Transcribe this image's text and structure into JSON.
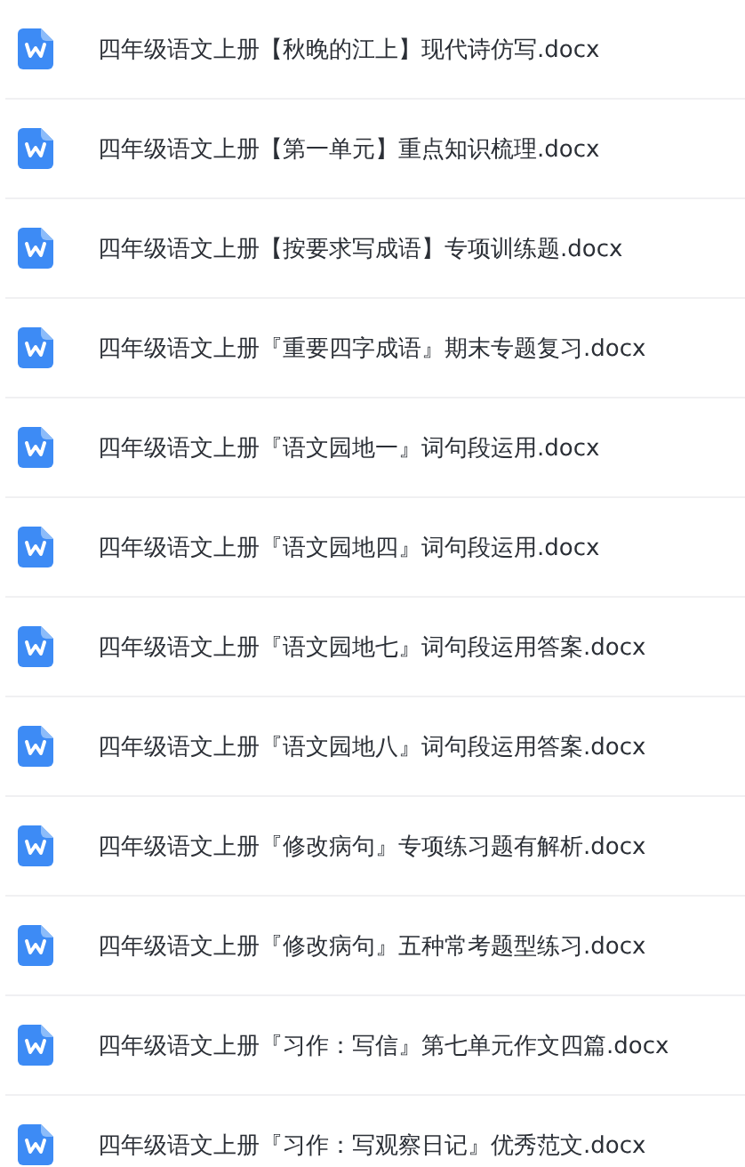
{
  "files": [
    {
      "name": "四年级语文上册【秋晚的江上】现代诗仿写.docx",
      "kind": "word"
    },
    {
      "name": "四年级语文上册【第一单元】重点知识梳理.docx",
      "kind": "word"
    },
    {
      "name": "四年级语文上册【按要求写成语】专项训练题.docx",
      "kind": "word"
    },
    {
      "name": "四年级语文上册『重要四字成语』期末专题复习.docx",
      "kind": "word"
    },
    {
      "name": "四年级语文上册『语文园地一』词句段运用.docx",
      "kind": "word"
    },
    {
      "name": "四年级语文上册『语文园地四』词句段运用.docx",
      "kind": "word"
    },
    {
      "name": "四年级语文上册『语文园地七』词句段运用答案.docx",
      "kind": "word"
    },
    {
      "name": "四年级语文上册『语文园地八』词句段运用答案.docx",
      "kind": "word"
    },
    {
      "name": "四年级语文上册『修改病句』专项练习题有解析.docx",
      "kind": "word"
    },
    {
      "name": "四年级语文上册『修改病句』五种常考题型练习.docx",
      "kind": "word"
    },
    {
      "name": "四年级语文上册『习作：写信』第七单元作文四篇.docx",
      "kind": "word"
    },
    {
      "name": "四年级语文上册『习作：写观察日记』优秀范文.docx",
      "kind": "word"
    }
  ]
}
